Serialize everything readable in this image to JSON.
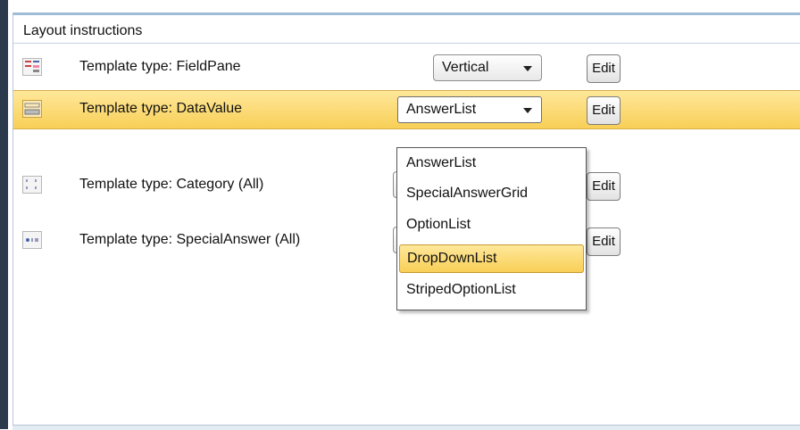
{
  "panel": {
    "title": "Layout instructions"
  },
  "rows": [
    {
      "label": "Template type: FieldPane",
      "icon": "fieldpane-template-icon",
      "dropdown_value": "Vertical",
      "edit_label": "Edit"
    },
    {
      "label": "Template type: DataValue",
      "icon": "datavalue-template-icon",
      "dropdown_value": "AnswerList",
      "edit_label": "Edit"
    },
    {
      "label": "Template type: Category (All)",
      "icon": "category-template-icon",
      "dropdown_value": "",
      "edit_label": "Edit"
    },
    {
      "label": "Template type: SpecialAnswer (All)",
      "icon": "specialanswer-template-icon",
      "dropdown_value": "",
      "edit_label": "Edit"
    }
  ],
  "dropdown_menu": {
    "options": [
      "AnswerList",
      "SpecialAnswerGrid",
      "OptionList",
      "DropDownList",
      "StripedOptionList"
    ],
    "highlighted": "DropDownList"
  },
  "colors": {
    "selected_row": "#f8cf57",
    "accent_border": "#9fbcd6",
    "left_bar": "#2b3a4c"
  }
}
